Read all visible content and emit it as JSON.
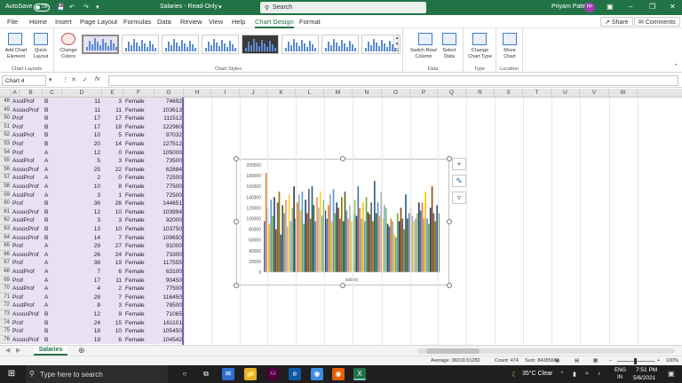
{
  "titlebar": {
    "autosave_label": "AutoSave",
    "autosave_state": "Off",
    "file_title": "Salaries - Read-Only",
    "search_placeholder": "Search",
    "user_name": "Priyam Patel",
    "user_initials": "PP"
  },
  "menu": {
    "tabs": [
      "File",
      "Home",
      "Insert",
      "Page Layout",
      "Formulas",
      "Data",
      "Review",
      "View",
      "Help",
      "Chart Design",
      "Format"
    ],
    "active_tab": "Chart Design",
    "share_label": "Share",
    "comments_label": "Comments"
  },
  "ribbon": {
    "add_chart_element": "Add Chart Element",
    "quick_layout": "Quick Layout",
    "chart_layouts_group": "Chart Layouts",
    "change_colors": "Change Colors",
    "chart_styles_group": "Chart Styles",
    "switch_row_column": "Switch Row/ Column",
    "select_data": "Select Data",
    "data_group": "Data",
    "change_chart_type": "Change Chart Type",
    "type_group": "Type",
    "move_chart": "Move Chart",
    "location_group": "Location"
  },
  "formula_bar": {
    "name_box": "Chart 4",
    "fx_symbol": "fx",
    "value": ""
  },
  "columns": [
    "A",
    "B",
    "C",
    "D",
    "E",
    "F",
    "G",
    "H",
    "I",
    "J",
    "K",
    "L",
    "M",
    "N",
    "O",
    "P",
    "Q",
    "R",
    "S",
    "T",
    "U",
    "V",
    "W"
  ],
  "rows": [
    {
      "n": "48",
      "a": "AsstProf",
      "b": "B",
      "c": "11",
      "d": "3",
      "e": "Female",
      "f": "74692"
    },
    {
      "n": "49",
      "a": "AssocProf",
      "b": "B",
      "c": "11",
      "d": "11",
      "e": "Female",
      "f": "103613"
    },
    {
      "n": "50",
      "a": "Prof",
      "b": "B",
      "c": "17",
      "d": "17",
      "e": "Female",
      "f": "111512"
    },
    {
      "n": "51",
      "a": "Prof",
      "b": "B",
      "c": "17",
      "d": "18",
      "e": "Female",
      "f": "122960"
    },
    {
      "n": "52",
      "a": "AsstProf",
      "b": "B",
      "c": "10",
      "d": "5",
      "e": "Female",
      "f": "97032"
    },
    {
      "n": "53",
      "a": "Prof",
      "b": "B",
      "c": "20",
      "d": "14",
      "e": "Female",
      "f": "127512"
    },
    {
      "n": "54",
      "a": "Prof",
      "b": "A",
      "c": "12",
      "d": "0",
      "e": "Female",
      "f": "105000"
    },
    {
      "n": "55",
      "a": "AsstProf",
      "b": "A",
      "c": "5",
      "d": "3",
      "e": "Female",
      "f": "73500"
    },
    {
      "n": "56",
      "a": "AssocProf",
      "b": "A",
      "c": "25",
      "d": "22",
      "e": "Female",
      "f": "62884"
    },
    {
      "n": "57",
      "a": "AsstProf",
      "b": "A",
      "c": "2",
      "d": "0",
      "e": "Female",
      "f": "72500"
    },
    {
      "n": "58",
      "a": "AssocProf",
      "b": "A",
      "c": "10",
      "d": "8",
      "e": "Female",
      "f": "77500"
    },
    {
      "n": "59",
      "a": "AsstProf",
      "b": "A",
      "c": "3",
      "d": "1",
      "e": "Female",
      "f": "72500"
    },
    {
      "n": "60",
      "a": "Prof",
      "b": "B",
      "c": "36",
      "d": "26",
      "e": "Female",
      "f": "144651"
    },
    {
      "n": "61",
      "a": "AssocProf",
      "b": "B",
      "c": "12",
      "d": "10",
      "e": "Female",
      "f": "103994"
    },
    {
      "n": "62",
      "a": "AsstProf",
      "b": "B",
      "c": "3",
      "d": "3",
      "e": "Female",
      "f": "92000"
    },
    {
      "n": "63",
      "a": "AssocProf",
      "b": "B",
      "c": "13",
      "d": "10",
      "e": "Female",
      "f": "103750"
    },
    {
      "n": "64",
      "a": "AssocProf",
      "b": "B",
      "c": "14",
      "d": "7",
      "e": "Female",
      "f": "109650"
    },
    {
      "n": "65",
      "a": "Prof",
      "b": "A",
      "c": "29",
      "d": "27",
      "e": "Female",
      "f": "91000"
    },
    {
      "n": "66",
      "a": "AssocProf",
      "b": "A",
      "c": "26",
      "d": "24",
      "e": "Female",
      "f": "73300"
    },
    {
      "n": "67",
      "a": "Prof",
      "b": "A",
      "c": "36",
      "d": "19",
      "e": "Female",
      "f": "117555"
    },
    {
      "n": "68",
      "a": "AsstProf",
      "b": "A",
      "c": "7",
      "d": "6",
      "e": "Female",
      "f": "63100"
    },
    {
      "n": "69",
      "a": "Prof",
      "b": "A",
      "c": "17",
      "d": "11",
      "e": "Female",
      "f": "90450"
    },
    {
      "n": "70",
      "a": "AsstProf",
      "b": "A",
      "c": "4",
      "d": "2",
      "e": "Female",
      "f": "77500"
    },
    {
      "n": "71",
      "a": "Prof",
      "b": "A",
      "c": "28",
      "d": "7",
      "e": "Female",
      "f": "116450"
    },
    {
      "n": "72",
      "a": "AsstProf",
      "b": "A",
      "c": "8",
      "d": "3",
      "e": "Female",
      "f": "78500"
    },
    {
      "n": "73",
      "a": "AssocProf",
      "b": "B",
      "c": "12",
      "d": "9",
      "e": "Female",
      "f": "71065"
    },
    {
      "n": "74",
      "a": "Prof",
      "b": "B",
      "c": "24",
      "d": "15",
      "e": "Female",
      "f": "161101"
    },
    {
      "n": "75",
      "a": "Prof",
      "b": "B",
      "c": "18",
      "d": "10",
      "e": "Female",
      "f": "105450"
    },
    {
      "n": "76",
      "a": "AssocProf",
      "b": "B",
      "c": "19",
      "d": "6",
      "e": "Female",
      "f": "104542"
    }
  ],
  "chart_data": {
    "type": "bar",
    "xlabel": "salary",
    "ylim": [
      0,
      200000
    ],
    "yticks": [
      "200000",
      "180000",
      "160000",
      "140000",
      "120000",
      "100000",
      "80000",
      "60000",
      "40000",
      "20000",
      "0"
    ],
    "grid": false,
    "values": [
      95000,
      185000,
      120000,
      90000,
      135000,
      105000,
      140000,
      80000,
      130000,
      150000,
      70000,
      125000,
      110000,
      135000,
      85000,
      145000,
      95000,
      120000,
      160000,
      100000,
      130000,
      145000,
      115000,
      150000,
      90000,
      135000,
      110000,
      155000,
      100000,
      160000,
      125000,
      95000,
      140000,
      120000,
      150000,
      105000,
      135000,
      115000,
      100000,
      125000,
      145000,
      95000,
      155000,
      110000,
      130000,
      120000,
      100000,
      140000,
      95000,
      150000,
      115000,
      100000,
      125000,
      95000,
      110000,
      135000,
      105000,
      160000,
      120000,
      100000,
      130000,
      95000,
      140000,
      112000,
      108000,
      130000,
      95000,
      170000,
      110000,
      130000,
      105000,
      150000,
      100000,
      125000,
      120000,
      90000,
      85000,
      100000,
      95000,
      70000,
      65000,
      110000,
      95000,
      120000,
      100000,
      80000,
      145000,
      100000,
      110000,
      120000,
      105000,
      95000,
      100000,
      110000,
      130000,
      115000,
      130000,
      100000,
      150000,
      100000,
      90000,
      120000,
      160000,
      110000,
      95000,
      125000,
      110000
    ],
    "palette": [
      "#4472c4",
      "#ed7d31",
      "#a5a5a5",
      "#ffc000",
      "#5b9bd5",
      "#70ad47",
      "#264478",
      "#9e480e",
      "#636363",
      "#997300",
      "#255e91",
      "#43682b",
      "#698ed0",
      "#f1975a",
      "#b7b7b7",
      "#ffcd33",
      "#7cafdd",
      "#8cc168",
      "#333f50"
    ]
  },
  "sheet": {
    "tab_label": "Salaries"
  },
  "status": {
    "average": "Average: 36019.51282",
    "count": "Count: 474",
    "sum": "Sum: 8428566",
    "zoom": "100%"
  },
  "taskbar": {
    "search_placeholder": "Type here to search",
    "weather": "35°C Clear",
    "lang": "ENG",
    "region": "IN",
    "time": "7:51 PM",
    "date": "5/6/2021"
  }
}
